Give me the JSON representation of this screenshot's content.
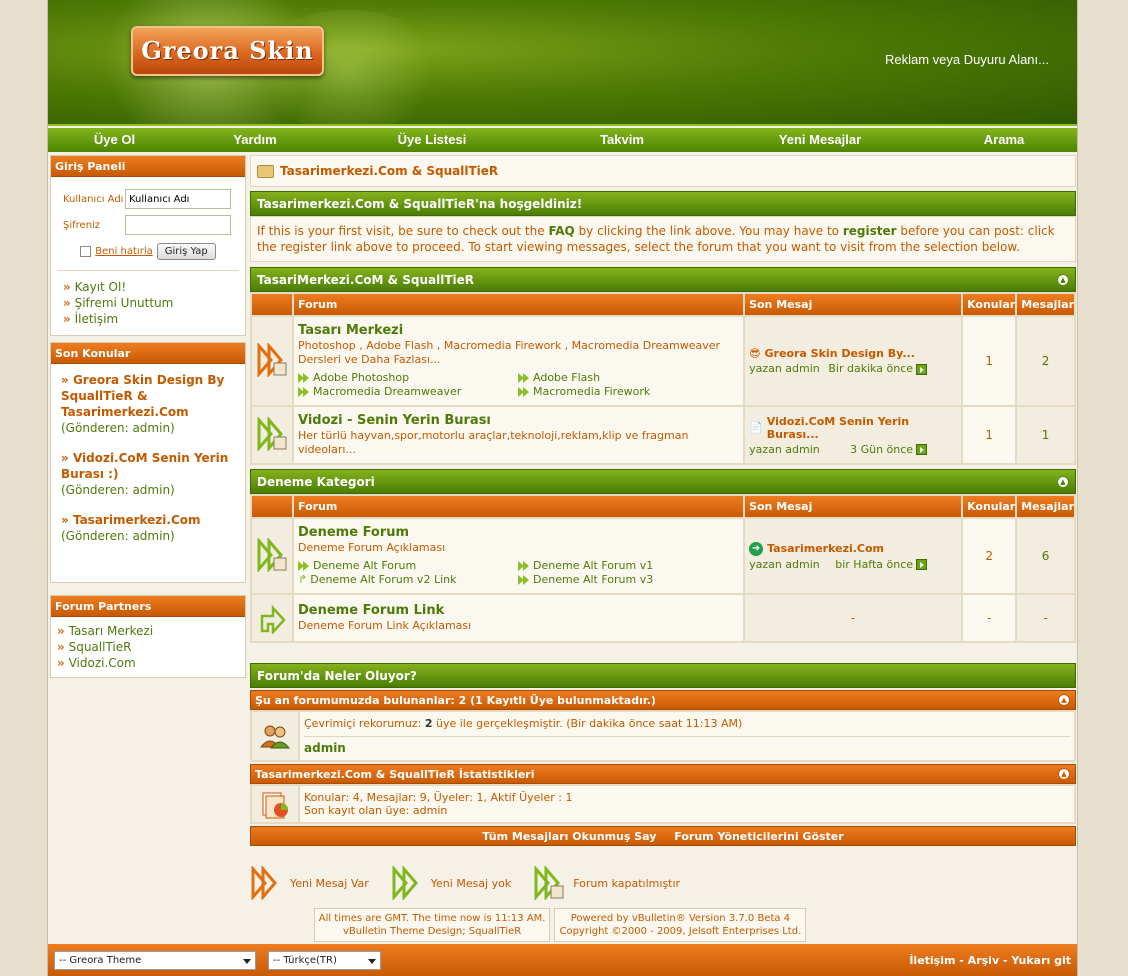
{
  "header": {
    "logo_text": "Greora Skin",
    "ad_text": "Reklam veya Duyuru Alanı..."
  },
  "nav": [
    "Üye Ol",
    "Yardım",
    "Üye Listesi",
    "Takvim",
    "Yeni Mesajlar",
    "Arama"
  ],
  "login": {
    "title": "Giriş Paneli",
    "username_label": "Kullanıcı Adı",
    "username_value": "Kullanıcı Adı",
    "password_label": "Şifreniz",
    "remember_label": "Beni hatırla",
    "submit_label": "Giriş Yap",
    "links": [
      "Kayıt Ol!",
      "Şifremi Unuttum",
      "İletişim"
    ]
  },
  "recent": {
    "title": "Son Konular",
    "items": [
      {
        "title": "Greora Skin Design By SquallTieR & Tasarimerkezi.Com",
        "by": "(Gönderen: admin)"
      },
      {
        "title": "Vidozi.CoM Senin Yerin Burası :)",
        "by": "(Gönderen: admin)"
      },
      {
        "title": "Tasarimerkezi.Com",
        "by": "(Gönderen: admin)"
      }
    ]
  },
  "partners": {
    "title": "Forum Partners",
    "items": [
      "Tasarı Merkezi",
      "SquallTieR",
      "Vidozi.Com"
    ]
  },
  "breadcrumb": "Tasarimerkezi.Com & SquallTieR",
  "welcome": {
    "title": "Tasarimerkezi.Com & SquallTieR'na hoşgeldiniz!",
    "t1": "If this is your first visit, be sure to check out the ",
    "faq": "FAQ",
    "t2": " by clicking the link above. You may have to ",
    "register": "register",
    "t3": " before you can post: click the register link above to proceed. To start viewing messages, select the forum that you want to visit from the selection below."
  },
  "columns": {
    "forum": "Forum",
    "last": "Son Mesaj",
    "threads": "Konular",
    "posts": "Mesajlar"
  },
  "cat1": {
    "title": "TasariMerkezi.CoM & SquallTieR",
    "f1": {
      "name": "Tasarı Merkezi",
      "desc": "Photoshop , Adobe Flash , Macromedia Firework , Macromedia Dreamweaver Dersleri ve Daha Fazlası...",
      "subs": [
        "Adobe Photoshop",
        "Adobe Flash",
        "Macromedia Dreamweaver",
        "Macromedia Firework"
      ],
      "last_title": "Greora Skin Design By...",
      "last_by": "yazan admin",
      "last_time": "Bir dakika önce",
      "threads": "1",
      "posts": "2"
    },
    "f2": {
      "name": "Vidozi - Senin Yerin Burası",
      "desc": "Her türlü hayvan,spor,motorlu araçlar,teknoloji,reklam,klip ve fragman videoları...",
      "last_title": "Vidozi.CoM Senin Yerin Burası...",
      "last_by": "yazan admin",
      "last_time": "3 Gün önce",
      "threads": "1",
      "posts": "1"
    }
  },
  "cat2": {
    "title": "Deneme Kategori",
    "f1": {
      "name": "Deneme Forum",
      "desc": "Deneme Forum Açıklaması",
      "subs": [
        "Deneme Alt Forum",
        "Deneme Alt Forum v1",
        "Deneme Alt Forum v2 Link",
        "Deneme Alt Forum v3"
      ],
      "last_title": "Tasarimerkezi.Com",
      "last_by": "yazan admin",
      "last_time": "bir Hafta önce",
      "threads": "2",
      "posts": "6"
    },
    "f2": {
      "name": "Deneme Forum Link",
      "desc": "Deneme Forum Link Açıklaması",
      "last": "-",
      "threads": "-",
      "posts": "-"
    }
  },
  "whats_going_on": {
    "title": "Forum'da Neler Oluyor?",
    "online_title": "Şu an forumumuzda bulunanlar: 2 (1 Kayıtlı Üye bulunmaktadır.)",
    "record_a": "Çevrimiçi rekorumuz: ",
    "record_n": "2",
    "record_b": " üye ile gerçekleşmiştir. (Bir dakika önce saat 11:13 AM)",
    "online_user": "admin",
    "stats_title": "Tasarimerkezi.Com & SquallTieR İstatistikleri",
    "stats_line": "Konular: 4, Mesajlar: 9, Üyeler: 1, Aktif Üyeler : 1",
    "newest_label": "Son kayıt olan üye: ",
    "newest_user": "admin",
    "mark_read": "Tüm Mesajları Okunmuş Say",
    "show_mods": "Forum Yöneticilerini Göster"
  },
  "legend": [
    "Yeni Mesaj Var",
    "Yeni Mesaj yok",
    "Forum kapatılmıştır"
  ],
  "footer": {
    "time1": "All times are GMT. The time now is 11:13 AM.",
    "time2": "vBulletin Theme Design; SquallTieR",
    "powered1": "Powered by vBulletin® Version 3.7.0 Beta 4",
    "powered2": "Copyright ©2000 - 2009, Jelsoft Enterprises Ltd.",
    "theme_select": "-- Greora Theme",
    "lang_select": "-- Türkçe(TR)",
    "links": "İletişim - Arşiv - Yukarı git"
  },
  "colors": {
    "green": "#4f7a0a",
    "orange": "#c45a00",
    "header_green": "#4e7a05",
    "bar_orange": "#e06b10"
  }
}
